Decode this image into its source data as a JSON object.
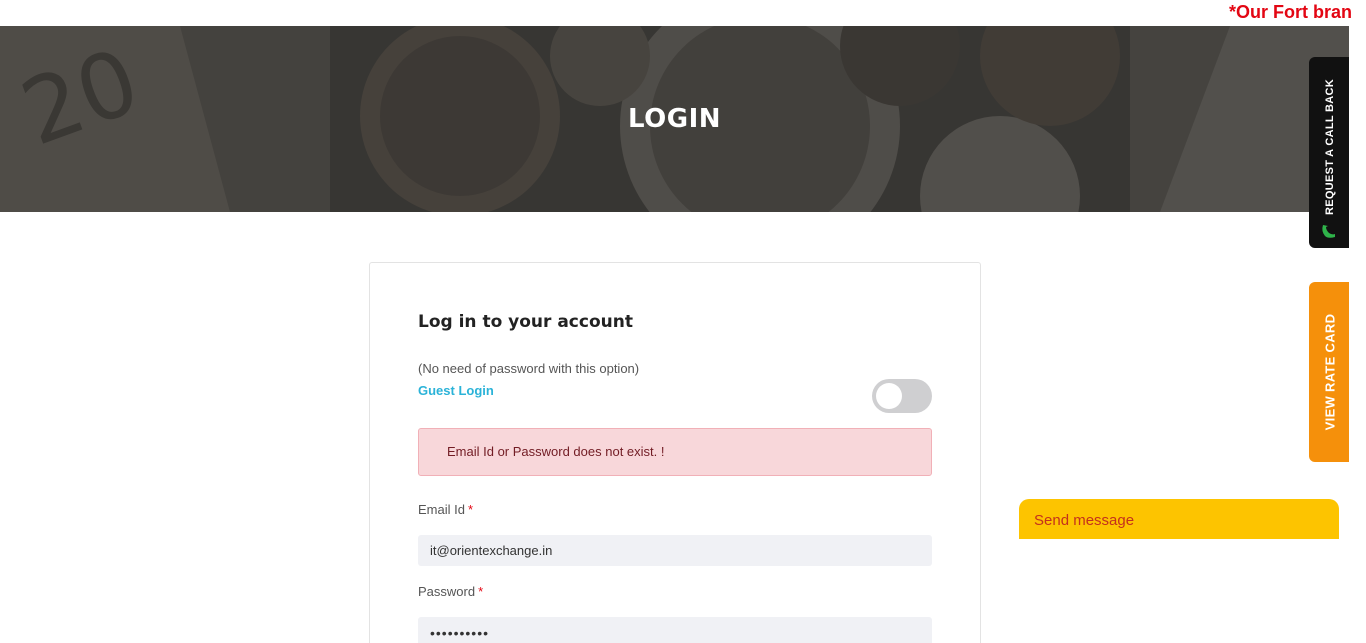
{
  "ticker": {
    "text": "*Our Fort bran"
  },
  "hero": {
    "title": "LOGIN"
  },
  "login_card": {
    "title": "Log in to your account",
    "guest_note": "(No need of password with this option)",
    "guest_label": "Guest Login",
    "guest_toggle_on": false,
    "error_message": "Email Id or Password does not exist. !",
    "email_label": "Email Id",
    "email_value": "it@orientexchange.in",
    "password_label": "Password",
    "password_value": "••••••••••",
    "required_mark": "*"
  },
  "side_tabs": {
    "callback_label": "REQUEST A CALL BACK",
    "rate_card_label": "VIEW RATE CARD"
  },
  "chat_widget": {
    "label": "Send message"
  },
  "colors": {
    "accent_red": "#e30613",
    "link_blue": "#2bb3d8",
    "rate_orange": "#f5900b",
    "chat_yellow": "#fdc400",
    "alert_bg": "#f8d7da"
  }
}
